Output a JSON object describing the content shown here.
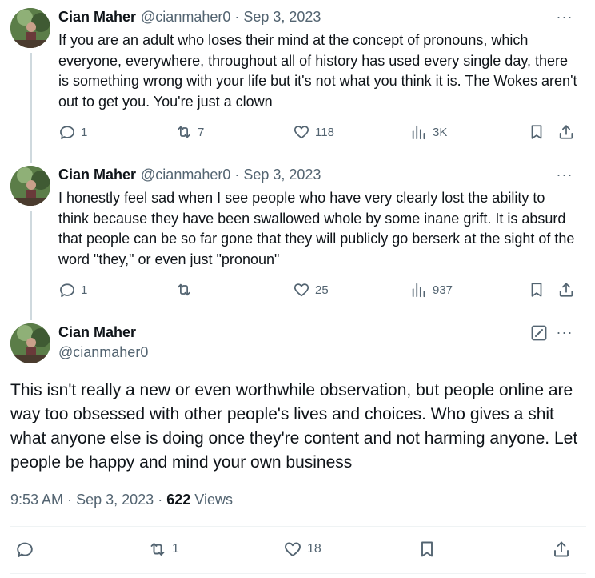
{
  "tweets": [
    {
      "name": "Cian Maher",
      "handle": "@cianmaher0",
      "separator": "·",
      "date": "Sep 3, 2023",
      "text": "If you are an adult who loses their mind at the concept of pronouns, which everyone, everywhere, throughout all of history has used every single day, there is something wrong with your life but it's not what you think it is. The Wokes aren't out to get you. You're just a clown",
      "replies": "1",
      "retweets": "7",
      "likes": "118",
      "views": "3K",
      "more_label": "···"
    },
    {
      "name": "Cian Maher",
      "handle": "@cianmaher0",
      "separator": "·",
      "date": "Sep 3, 2023",
      "text": "I honestly feel sad when I see people who have very clearly lost the ability to think because they have been swallowed whole by some inane grift. It is absurd that people can be so far gone that they will publicly go berserk at the sight of the word \"they,\" or even just \"pronoun\"",
      "replies": "1",
      "retweets": "",
      "likes": "25",
      "views": "937",
      "more_label": "···"
    }
  ],
  "main_tweet": {
    "name": "Cian Maher",
    "handle": "@cianmaher0",
    "text": "This isn't really a new or even worthwhile observation, but people online are way too obsessed with other people's lives and choices. Who gives a shit what anyone else is doing once they're content and not harming anyone. Let people be happy and mind your own business",
    "time": "9:53 AM",
    "separator": "·",
    "date": "Sep 3, 2023",
    "separator2": "·",
    "views_count": "622",
    "views_label": "Views",
    "replies": "",
    "retweets": "1",
    "likes": "18",
    "more_label": "···"
  },
  "icons": {
    "reply": "reply-icon",
    "retweet": "retweet-icon",
    "like": "heart-icon",
    "views": "analytics-icon",
    "bookmark": "bookmark-icon",
    "share": "share-icon",
    "edit": "edit-icon",
    "more": "more-icon"
  },
  "colors": {
    "text": "#0f1419",
    "secondary": "#536471",
    "thread_line": "#cfd9de",
    "divider": "#eff3f4"
  }
}
